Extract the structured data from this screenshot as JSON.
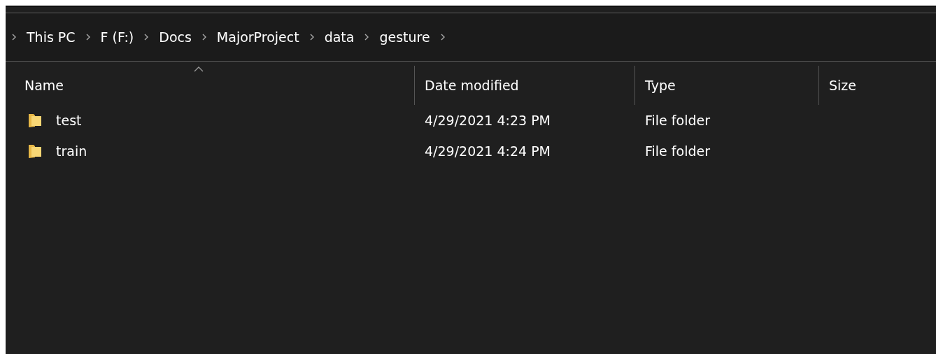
{
  "breadcrumb": [
    "This PC",
    "F (F:)",
    "Docs",
    "MajorProject",
    "data",
    "gesture"
  ],
  "table": {
    "columns": [
      {
        "label": "Name",
        "sorted": true
      },
      {
        "label": "Date modified",
        "sorted": false
      },
      {
        "label": "Type",
        "sorted": false
      },
      {
        "label": "Size",
        "sorted": false
      }
    ],
    "rows": [
      {
        "name": "test",
        "date": "4/29/2021 4:23 PM",
        "type": "File folder"
      },
      {
        "name": "train",
        "date": "4/29/2021 4:24 PM",
        "type": "File folder"
      }
    ]
  }
}
